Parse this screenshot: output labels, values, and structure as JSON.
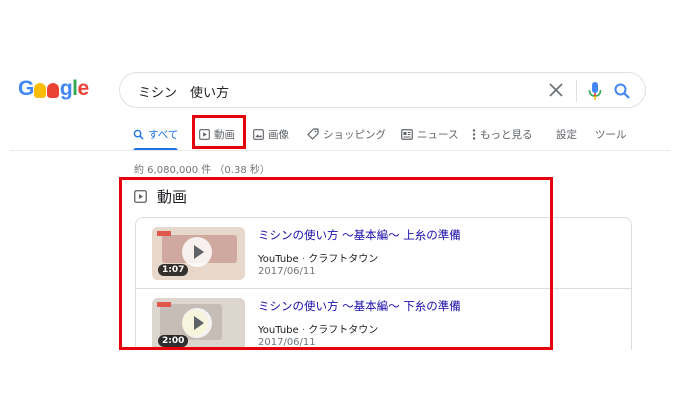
{
  "logo": {
    "text": "Google"
  },
  "search": {
    "query": "ミシン　使い方"
  },
  "tabs": [
    {
      "label": "すべて",
      "icon": "search-icon"
    },
    {
      "label": "動画",
      "icon": "video-icon"
    },
    {
      "label": "画像",
      "icon": "image-icon"
    },
    {
      "label": "ショッピング",
      "icon": "tag-icon"
    },
    {
      "label": "ニュース",
      "icon": "news-icon"
    },
    {
      "label": "もっと見る",
      "icon": "more-vert-icon"
    },
    {
      "label": "設定"
    },
    {
      "label": "ツール"
    }
  ],
  "stats": "約 6,080,000 件 （0.38 秒）",
  "videos_section": {
    "title": "動画",
    "items": [
      {
        "title": "ミシンの使い方 〜基本編〜 上糸の準備",
        "source": "YouTube",
        "channel": "クラフトタウン",
        "date": "2017/06/11",
        "duration": "1:07"
      },
      {
        "title": "ミシンの使い方 〜基本編〜 下糸の準備",
        "source": "YouTube",
        "channel": "クラフトタウン",
        "date": "2017/06/11",
        "duration": "2:00"
      }
    ]
  },
  "colors": {
    "accent": "#1a73e8",
    "highlight": "#e8000b",
    "link": "#1a0dab"
  }
}
